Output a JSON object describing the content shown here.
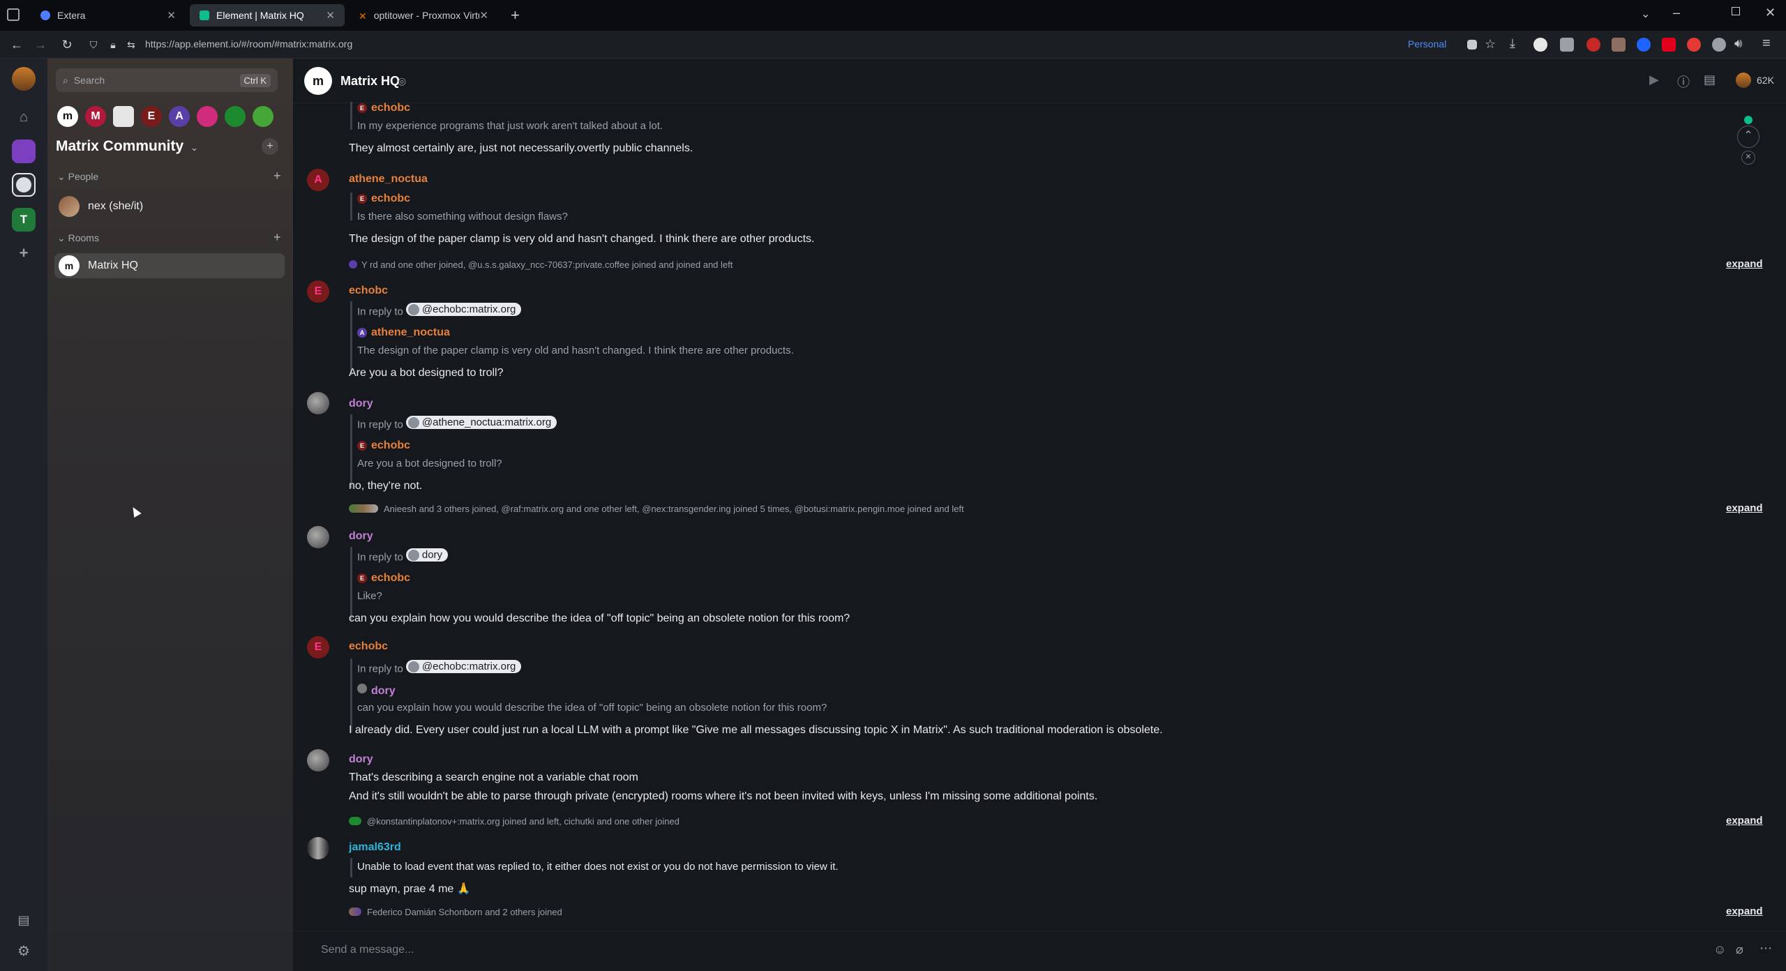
{
  "browser": {
    "tabs": [
      {
        "title": "Extera",
        "color": "#4d7cfe"
      },
      {
        "title": "Element | Matrix HQ",
        "color": "#0dbd8b"
      },
      {
        "title": "optitower - Proxmox Virtual En",
        "color": "#e57000"
      }
    ],
    "url": "https://app.element.io/#/room/#matrix:matrix.org",
    "profile_label": "Personal"
  },
  "spaces": [
    {
      "label": "",
      "color": "#7b3fbf"
    },
    {
      "label": "",
      "color": "#dcdfe3"
    },
    {
      "label": "T",
      "color": "#1f7a3a"
    }
  ],
  "roomlist": {
    "search_placeholder": "Search",
    "search_shortcut": "Ctrl K",
    "space_name": "Matrix Community",
    "mini_avatars": [
      {
        "label": "m",
        "color": "#ffffff"
      },
      {
        "label": "M",
        "color": "#b0193a"
      },
      {
        "label": "",
        "color": "#e6e6e6"
      },
      {
        "label": "E",
        "color": "#7a1b1b"
      },
      {
        "label": "A",
        "color": "#5b3fa8"
      },
      {
        "label": "",
        "color": "#d12b7c"
      },
      {
        "label": "",
        "color": "#1d8a2f"
      },
      {
        "label": "",
        "color": "#46a638"
      }
    ],
    "people_label": "People",
    "people": [
      {
        "name": "nex (she/it)"
      }
    ],
    "rooms_label": "Rooms",
    "rooms": [
      {
        "name": "Matrix HQ"
      }
    ]
  },
  "room": {
    "name": "Matrix HQ",
    "member_count": "62K",
    "composer_placeholder": "Send a message..."
  },
  "timeline": {
    "expand_label": "expand",
    "in_reply_to": "In reply to",
    "msg0": {
      "quote_sender": "echobc",
      "quote_text": "In my experience programs that just work aren't talked about a lot.",
      "body": "They almost certainly are, just not necessarily.overtly  public channels."
    },
    "msg1": {
      "sender": "athene_noctua",
      "avatar": "A",
      "quote_sender": "echobc",
      "quote_text": "Is there also something without design flaws?",
      "body": "The design of the paper clamp is very old and hasn't changed. I think there are other products."
    },
    "event1": "Y rd and one other joined, @u.s.s.galaxy_ncc-70637:private.coffee joined and joined and left",
    "msg2": {
      "sender": "echobc",
      "avatar": "E",
      "reply_pill": "@echobc:matrix.org",
      "quote_sender": "athene_noctua",
      "quote_text": "The design of the paper clamp is very old and hasn't changed. I think there are other products.",
      "body": "Are you a bot designed to troll?"
    },
    "msg3": {
      "sender": "dory",
      "reply_pill": "@athene_noctua:matrix.org",
      "quote_sender": "echobc",
      "quote_text": "Are you a bot designed to troll?",
      "body": "no, they're not."
    },
    "event2": "Anieesh and 3 others joined, @raf:matrix.org and one other left, @nex:transgender.ing joined 5 times, @botusi:matrix.pengin.moe joined and left",
    "msg4": {
      "sender": "dory",
      "reply_pill": "dory",
      "quote_sender": "echobc",
      "quote_text": "Like?",
      "body": "can you explain how you would describe the idea of \"off topic\" being an obsolete notion for this room?"
    },
    "msg5": {
      "sender": "echobc",
      "avatar": "E",
      "reply_pill": "@echobc:matrix.org",
      "quote_sender": "dory",
      "quote_text": "can you explain how you would describe the idea of \"off topic\" being an obsolete notion for this room?",
      "body": "I already did. Every user could just run a local LLM with a prompt like \"Give me all messages discussing topic X in Matrix\". As such traditional moderation is obsolete."
    },
    "msg6": {
      "sender": "dory",
      "body1": "That's describing a search engine not a variable chat room",
      "body2": "And it's still wouldn't be able to parse through private (encrypted) rooms where it's not been invited with keys, unless I'm missing some additional points."
    },
    "event3": "@konstantinplatonov+:matrix.org joined and left, cichutki and one other joined",
    "msg7": {
      "sender": "jamal63rd",
      "error": "Unable to load event that was replied to, it either does not exist or you do not have permission to view it.",
      "body": "sup mayn, prae 4 me 🙏"
    },
    "event4": "Federico Damián Schonborn and 2 others joined"
  },
  "colors": {
    "echobc": "#e8803a",
    "athene": "#e8803a",
    "dory": "#c17fd6",
    "jamal": "#2fb3d8"
  }
}
